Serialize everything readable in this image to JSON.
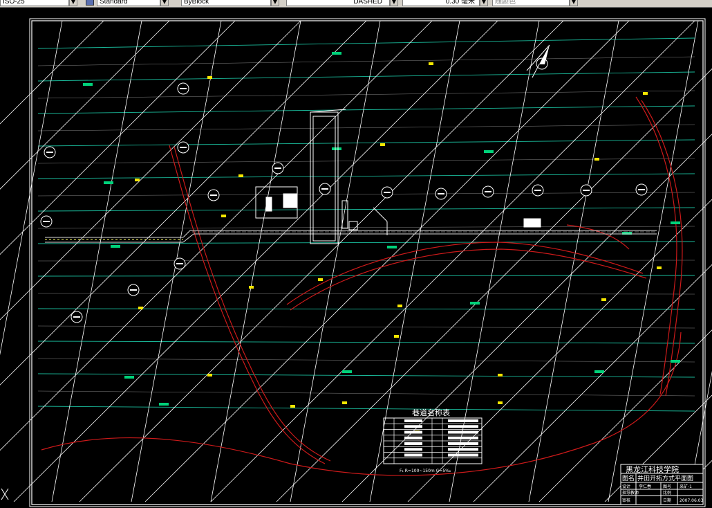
{
  "toolbar": {
    "textstyle": "ISO-25",
    "dimstyle": "Standard",
    "linetype_color": "ByBlock",
    "linetype": "DASHED",
    "lineweight": "0.30  毫米",
    "plotstyle": "随颜色"
  },
  "drawing": {
    "table_title": "巷道名称表",
    "table_note": "F₁ R=100~150m  G=5‰",
    "title_block": {
      "org": "黑龙江科技学院",
      "name_label": "图名",
      "name": "井田开拓方式平面图",
      "row1": [
        "设计",
        "李仁春",
        "图号",
        "采矿-1"
      ],
      "row2": [
        "指导教师",
        "",
        "比例",
        ""
      ],
      "row3": [
        "审核",
        "",
        "日期",
        "2007.06.03"
      ]
    }
  },
  "colors": {
    "background": "#000000",
    "contour": "#1abc9c",
    "grid": "#ffffff",
    "roadway": "#cc1a1a",
    "marker_yellow": "#f5e600",
    "marker_green": "#00d27a"
  },
  "ucs_icon": "ucs-x-icon",
  "north_arrow": "north-arrow-icon"
}
